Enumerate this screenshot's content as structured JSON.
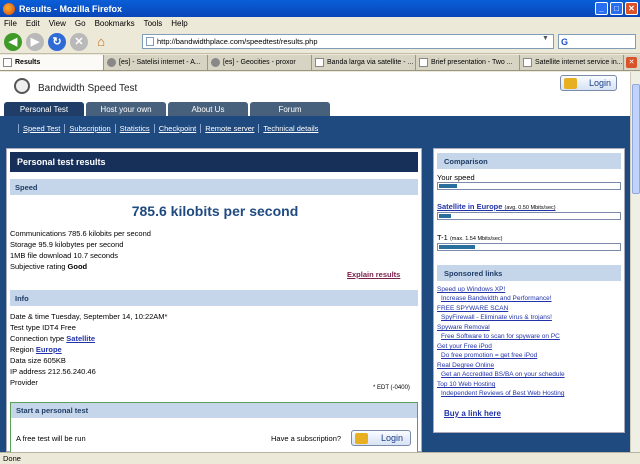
{
  "window": {
    "title": "Results - Mozilla Firefox"
  },
  "menu": [
    "File",
    "Edit",
    "View",
    "Go",
    "Bookmarks",
    "Tools",
    "Help"
  ],
  "url": "http://bandwidthplace.com/speedtest/results.php",
  "tabs": [
    {
      "label": "Results",
      "favicon": "doc"
    },
    {
      "label": "[es] - Satelisi internet - A...",
      "favicon": "globe"
    },
    {
      "label": "[es] - Geocities - proxor",
      "favicon": "globe"
    },
    {
      "label": "Banda larga via satellite - ...",
      "favicon": "doc"
    },
    {
      "label": "Brief presentation - Two ...",
      "favicon": "doc"
    },
    {
      "label": "Satellite internet service in...",
      "favicon": "doc"
    }
  ],
  "site": {
    "title": "Bandwidth Speed Test",
    "login_label": "Login",
    "nav_tabs": [
      "Personal Test",
      "Host your own",
      "About Us",
      "Forum"
    ],
    "subnav": [
      "Speed Test",
      "Subscription",
      "Statistics",
      "Checkpoint",
      "Remote server",
      "Technical details"
    ]
  },
  "results": {
    "panel_title": "Personal test results",
    "speed_heading": "Speed",
    "speed_value": "785.6 kilobits per second",
    "speed_rows": [
      {
        "label": "Communications",
        "value": "785.6 kilobits per second"
      },
      {
        "label": "Storage",
        "value": "95.9 kilobytes per second"
      },
      {
        "label": "1MB file download",
        "value": "10.7 seconds"
      },
      {
        "label": "Subjective rating",
        "value": "Good"
      }
    ],
    "explain_link": "Explain results",
    "info_heading": "Info",
    "info_rows": [
      {
        "label": "Date & time",
        "value": "Tuesday, September 14, 10:22AM*"
      },
      {
        "label": "Test type",
        "value": "IDT4 Free"
      },
      {
        "label": "Connection type",
        "value": "Satellite"
      },
      {
        "label": "Region",
        "value": "Europe"
      },
      {
        "label": "Data size",
        "value": "605KB"
      },
      {
        "label": "IP address",
        "value": "212.56.240.46"
      },
      {
        "label": "Provider",
        "value": ""
      }
    ],
    "edt_note": "* EDT (-0400)",
    "start_heading": "Start a personal test",
    "start_text": "A free test will be run",
    "have_subscription": "Have a subscription?",
    "login_label": "Login"
  },
  "comparison": {
    "heading": "Comparison",
    "rows": [
      {
        "label": "Your speed",
        "note": "",
        "fraction": 0.1,
        "link": false
      },
      {
        "label": "Satellite in Europe",
        "note": "(avg. 0.50 Mbits/sec)",
        "fraction": 0.065,
        "link": true
      },
      {
        "label": "T-1",
        "note": "(max. 1.54 Mbits/sec)",
        "fraction": 0.2,
        "link": false
      }
    ],
    "bar_color": "#2a6e9e"
  },
  "sponsored": {
    "heading": "Sponsored links",
    "ads": [
      {
        "title": "Speed up Windows XP!",
        "desc": "Increase Bandwidth and Performance!"
      },
      {
        "title": "FREE SPYWARE SCAN",
        "desc": "SpyFirewall - Eliminate virus & trojans!"
      },
      {
        "title": "Spyware Removal",
        "desc": "Free Software to scan for spyware on PC"
      },
      {
        "title": "Get your Free iPod",
        "desc": "Do free promotion = get free iPod"
      },
      {
        "title": "Real Degree Online",
        "desc": "Get an Accredited BS/BA on your schedule"
      },
      {
        "title": "Top 10 Web Hosting",
        "desc": "Independent Reviews of Best Web Hosting"
      }
    ],
    "buy_link": "Buy a link here"
  },
  "status": "Done"
}
